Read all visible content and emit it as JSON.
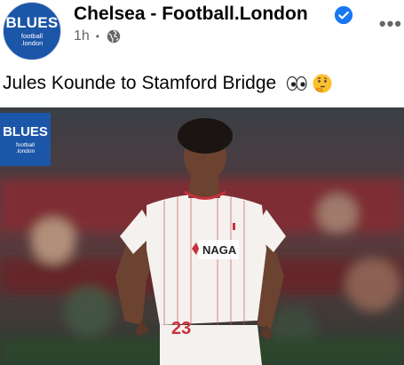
{
  "post": {
    "page_name": "Chelsea - Football.London",
    "time": "1h",
    "separator": "•",
    "text": "Jules Kounde to Stamford Bridge",
    "emojis": [
      "eyes-emoji",
      "thinking-face-emoji"
    ],
    "more_label": "•••"
  },
  "avatar": {
    "title": "BLUES",
    "subtitle_line1": "football",
    "subtitle_line2": ".london"
  },
  "photo": {
    "badge_title": "BLUES",
    "badge_line1": "football",
    "badge_line2": ".london",
    "sponsor": "NAGA",
    "shirt_number": "23",
    "subject": "Jules Kounde"
  },
  "colors": {
    "brand_blue": "#1c56a8",
    "verified_blue": "#1877f2",
    "meta_gray": "#65676b",
    "text": "#050505"
  }
}
